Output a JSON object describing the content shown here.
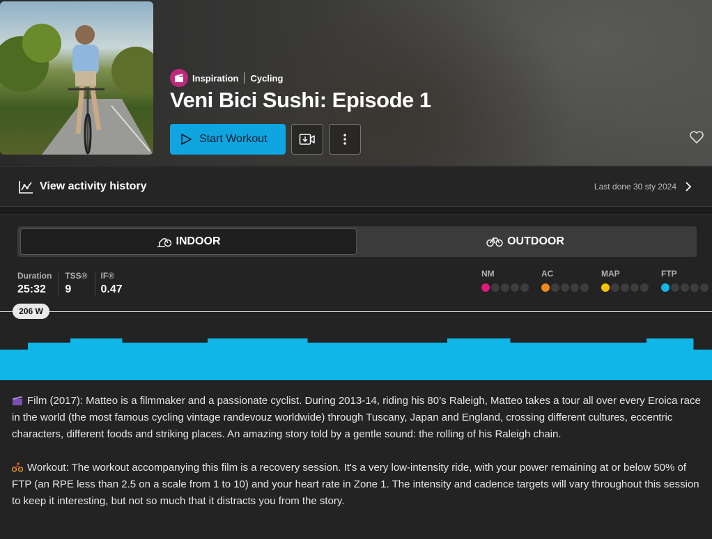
{
  "header": {
    "tags": [
      "Inspiration",
      "Cycling"
    ],
    "title": "Veni Bici Sushi: Episode 1",
    "start_label": "Start Workout",
    "icons": {
      "category": "clapper-icon",
      "start": "play-icon",
      "video": "video-download-icon",
      "more": "more-vertical-icon",
      "favorite": "heart-icon"
    }
  },
  "activity": {
    "label": "View activity history",
    "last_done": "Last done 30 sty 2024",
    "icons": {
      "left": "activity-chart-icon",
      "right": "chevron-right-icon"
    }
  },
  "mode_toggle": {
    "options": [
      {
        "label": "INDOOR",
        "icon": "indoor-bike-icon",
        "selected": true
      },
      {
        "label": "OUTDOOR",
        "icon": "bike-icon",
        "selected": false
      }
    ]
  },
  "stats": [
    {
      "label": "Duration",
      "value": "25:32"
    },
    {
      "label": "TSS®",
      "value": "9"
    },
    {
      "label": "IF®",
      "value": "0.47"
    }
  ],
  "zones": [
    {
      "label": "NM",
      "level": 1,
      "color": "#e0197d"
    },
    {
      "label": "AC",
      "level": 1,
      "color": "#f08a1c"
    },
    {
      "label": "MAP",
      "level": 1,
      "color": "#f5c400"
    },
    {
      "label": "FTP",
      "level": 1,
      "color": "#16b4e6"
    }
  ],
  "ftp_badge": "206 W",
  "profile": {
    "color": "#0fb6e8",
    "segments": [
      {
        "pct": 0.45
      },
      {
        "pct": 0.56
      },
      {
        "pct": 0.62
      },
      {
        "pct": 0.56
      },
      {
        "pct": 0.62
      },
      {
        "pct": 0.56
      },
      {
        "pct": 0.62
      },
      {
        "pct": 0.56
      },
      {
        "pct": 0.62
      },
      {
        "pct": 0.45
      }
    ]
  },
  "description": [
    "Film (2017): Matteo is a filmmaker and a passionate cyclist. During 2013-14, riding his 80’s Raleigh, Matteo takes a tour all over every Eroica race in the world (the most famous cycling vintage randevouz worldwide) through Tuscany, Japan and England, crossing different cultures, eccentric characters, different foods and striking places. An amazing story told by a gentle sound: the rolling of his Raleigh chain.",
    "Workout: The workout accompanying this film is a recovery session. It's a very low-intensity ride, with your power remaining at or below 50% of FTP (an RPE less than 2.5 on a scale from 1 to 10) and your heart rate in Zone 1. The intensity and cadence targets will vary throughout this session to keep it interesting, but not so much that it distracts you from the story."
  ],
  "description_icons": [
    "film-clapper-icon",
    "cyclist-icon"
  ]
}
